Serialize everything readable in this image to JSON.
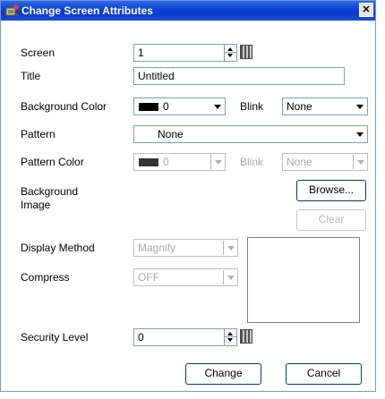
{
  "title": "Change Screen Attributes",
  "close_label": "✕",
  "labels": {
    "screen": "Screen",
    "title": "Title",
    "background_color": "Background Color",
    "blink": "Blink",
    "pattern": "Pattern",
    "pattern_color": "Pattern Color",
    "pattern_blink": "Blink",
    "background_image_line1": "Background",
    "background_image_line2": "Image",
    "display_method": "Display Method",
    "compress": "Compress",
    "security_level": "Security Level"
  },
  "fields": {
    "screen_value": "1",
    "title_value": "Untitled",
    "background_color_value": "0",
    "blink_value": "None",
    "pattern_value": "None",
    "pattern_color_value": "0",
    "pattern_blink_value": "None",
    "display_method_value": "Magnify",
    "compress_value": "OFF",
    "security_level_value": "0"
  },
  "buttons": {
    "browse": "Browse...",
    "clear": "Clear",
    "change": "Change",
    "cancel": "Cancel"
  }
}
